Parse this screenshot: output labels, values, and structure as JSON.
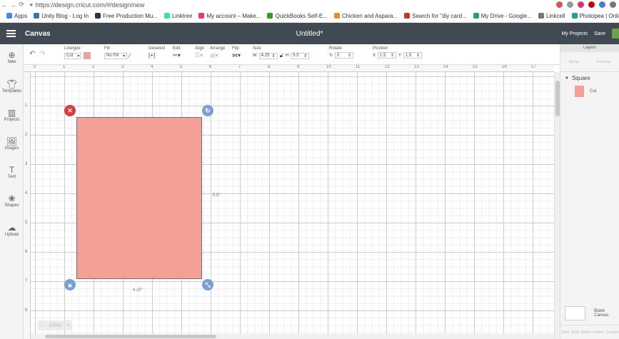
{
  "browser": {
    "url": "https://design.cricut.com/#/design/new",
    "bookmarks": [
      {
        "label": "Apps",
        "color": "#4285f4"
      },
      {
        "label": "Unity Blog - Log In",
        "color": "#3b74b3"
      },
      {
        "label": "Free Production Mu...",
        "color": "#22334c"
      },
      {
        "label": "Linktree",
        "color": "#39e09b"
      },
      {
        "label": "My account – Make...",
        "color": "#e8396b"
      },
      {
        "label": "QuickBooks Self-E...",
        "color": "#2ca01c"
      },
      {
        "label": "Chicken and Aspara...",
        "color": "#f08a24"
      },
      {
        "label": "Search for \"diy card...",
        "color": "#c0392b"
      },
      {
        "label": "My Drive - Google...",
        "color": "#1fa463"
      },
      {
        "label": "Linkcell",
        "color": "#777777"
      },
      {
        "label": "Photopea | Online I...",
        "color": "#18a497"
      }
    ]
  },
  "header": {
    "app_title": "Canvas",
    "doc_title": "Untitled*",
    "my_projects": "My Projects",
    "save": "Save"
  },
  "toolbar": {
    "linetype_label": "Linetype",
    "linetype_value": "Cut",
    "fill_label": "Fill",
    "fill_value": "No Fill",
    "deselect_label": "Deselect",
    "edit_label": "Edit",
    "align_label": "Align",
    "arrange_label": "Arrange",
    "flip_label": "Flip",
    "size_label": "Size",
    "size_w_label": "W",
    "size_w": "4.25",
    "size_h_label": "H",
    "size_h": "5.5",
    "rotate_label": "Rotate",
    "rotate_value": "0",
    "position_label": "Position",
    "pos_x_label": "X",
    "pos_x": "1.5",
    "pos_y_label": "Y",
    "pos_y": "1.5"
  },
  "sidebar": {
    "items": [
      {
        "label": "New",
        "icon": "plus-circle-icon"
      },
      {
        "label": "Templates",
        "icon": "shirt-icon"
      },
      {
        "label": "Projects",
        "icon": "projects-icon"
      },
      {
        "label": "Images",
        "icon": "image-icon"
      },
      {
        "label": "Text",
        "icon": "text-icon"
      },
      {
        "label": "Shapes",
        "icon": "shapes-icon"
      },
      {
        "label": "Upload",
        "icon": "upload-icon"
      }
    ]
  },
  "canvas": {
    "ruler_top": [
      "0",
      "1",
      "2",
      "3",
      "4",
      "5",
      "6",
      "7",
      "8",
      "9",
      "10",
      "11",
      "12",
      "13",
      "14",
      "15",
      "16",
      "17"
    ],
    "ruler_left": [
      "1",
      "2",
      "3",
      "4",
      "5",
      "6",
      "7",
      "8"
    ],
    "width_label": "4.25\"",
    "height_label": "5.5\"",
    "shape_color": "#f4a097",
    "zoom_label": "100%"
  },
  "layers": {
    "title": "Layers",
    "group_label": "Group",
    "ungroup_label": "UnGroup",
    "layer_name": "Square",
    "layer_type": "Cut",
    "blank_canvas": "Blank Canvas",
    "bottom_tools": [
      "Slice",
      "Weld",
      "Attach",
      "Flatten",
      "Contour"
    ]
  }
}
